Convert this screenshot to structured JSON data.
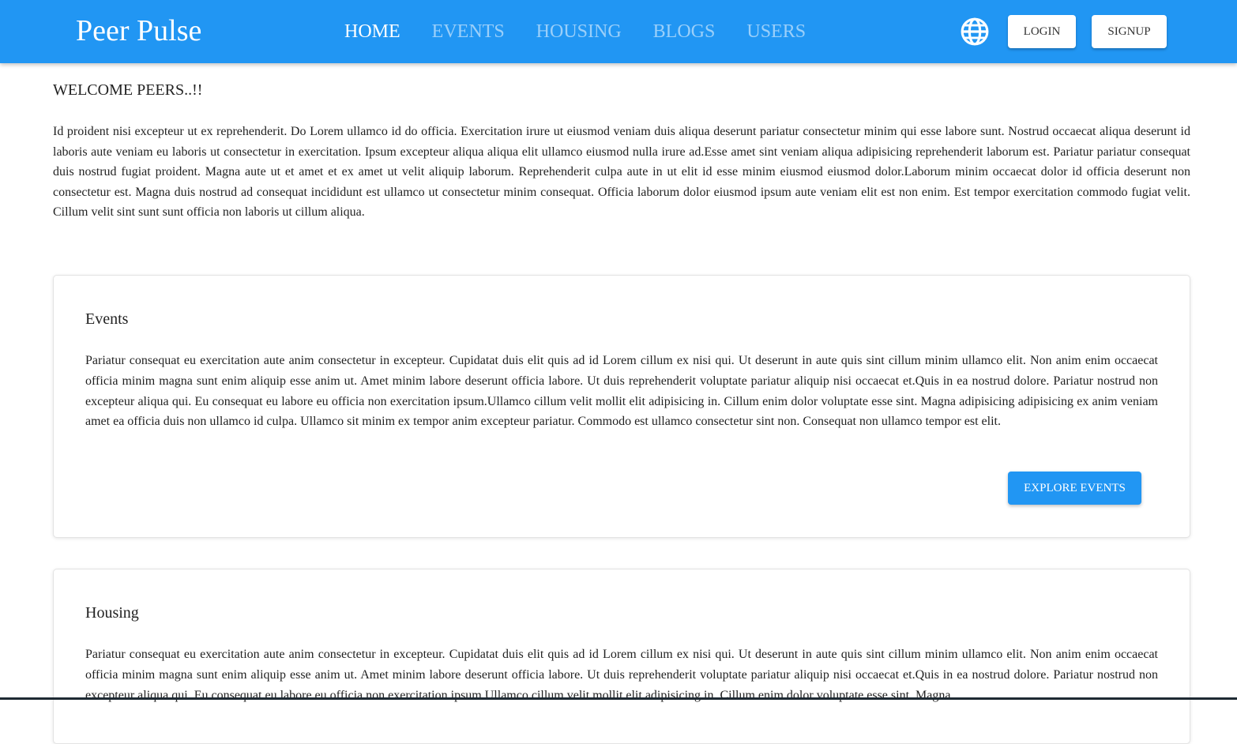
{
  "header": {
    "brand": "Peer Pulse",
    "nav": [
      {
        "label": "HOME",
        "active": true
      },
      {
        "label": "EVENTS",
        "active": false
      },
      {
        "label": "HOUSING",
        "active": false
      },
      {
        "label": "BLOGS",
        "active": false
      },
      {
        "label": "USERS",
        "active": false
      }
    ],
    "language_icon": "globe-icon",
    "login_label": "LOGIN",
    "signup_label": "SIGNUP"
  },
  "main": {
    "welcome": "WELCOME PEERS..!!",
    "intro": "Id proident nisi excepteur ut ex reprehenderit. Do Lorem ullamco id do officia. Exercitation irure ut eiusmod veniam duis aliqua deserunt pariatur consectetur minim qui esse labore sunt. Nostrud occaecat aliqua deserunt id laboris aute veniam eu laboris ut consectetur in exercitation. Ipsum excepteur aliqua aliqua elit ullamco eiusmod nulla irure ad.Esse amet sint veniam aliqua adipisicing reprehenderit laborum est. Pariatur pariatur consequat duis nostrud fugiat proident. Magna aute ut et amet et ex amet ut velit aliquip laborum. Reprehenderit culpa aute in ut elit id esse minim eiusmod eiusmod dolor.Laborum minim occaecat dolor id officia deserunt non consectetur est. Magna duis nostrud ad consequat incididunt est ullamco ut consectetur minim consequat. Officia laborum dolor eiusmod ipsum aute veniam elit est non enim. Est tempor exercitation commodo fugiat velit. Cillum velit sint sunt sunt officia non laboris ut cillum aliqua.",
    "cards": [
      {
        "title": "Events",
        "body": "Pariatur consequat eu exercitation aute anim consectetur in excepteur. Cupidatat duis elit quis ad id Lorem cillum ex nisi qui. Ut deserunt in aute quis sint cillum minim ullamco elit. Non anim enim occaecat officia minim magna sunt enim aliquip esse anim ut. Amet minim labore deserunt officia labore. Ut duis reprehenderit voluptate pariatur aliquip nisi occaecat et.Quis in ea nostrud dolore. Pariatur nostrud non excepteur aliqua qui. Eu consequat eu labore eu officia non exercitation ipsum.Ullamco cillum velit mollit elit adipisicing in. Cillum enim dolor voluptate esse sint. Magna adipisicing adipisicing ex anim veniam amet ea officia duis non ullamco id culpa. Ullamco sit minim ex tempor anim excepteur pariatur. Commodo est ullamco consectetur sint non. Consequat non ullamco tempor est elit.",
        "button": "EXPLORE EVENTS"
      },
      {
        "title": "Housing",
        "body": "Pariatur consequat eu exercitation aute anim consectetur in excepteur. Cupidatat duis elit quis ad id Lorem cillum ex nisi qui. Ut deserunt in aute quis sint cillum minim ullamco elit. Non anim enim occaecat officia minim magna sunt enim aliquip esse anim ut. Amet minim labore deserunt officia labore. Ut duis reprehenderit voluptate pariatur aliquip nisi occaecat et.Quis in ea nostrud dolore. Pariatur nostrud non excepteur aliqua qui. Eu consequat eu labore eu officia non exercitation ipsum.Ullamco cillum velit mollit elit adipisicing in. Cillum enim dolor voluptate esse sint. Magna"
      }
    ]
  },
  "colors": {
    "primary": "#2196f3",
    "text": "#222222"
  }
}
